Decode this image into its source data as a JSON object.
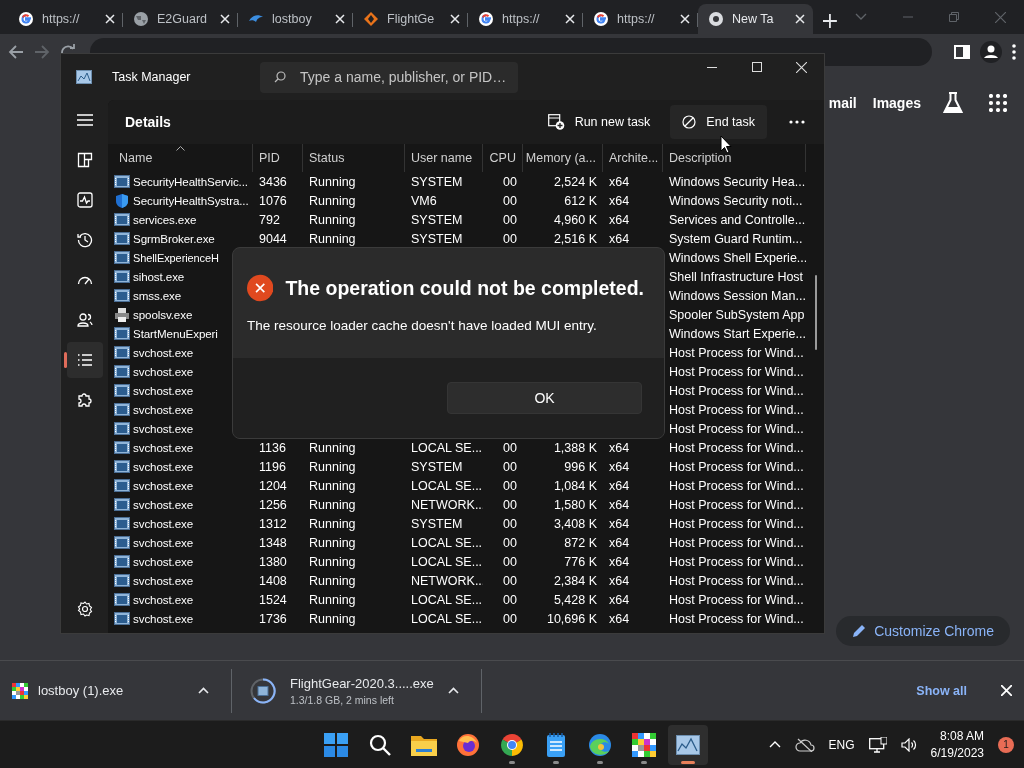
{
  "browser": {
    "tabs": [
      {
        "title": "https://",
        "kind": "google",
        "selected": false
      },
      {
        "title": "E2Guard",
        "kind": "globe",
        "selected": false
      },
      {
        "title": "lostboy",
        "kind": "swoosh",
        "selected": false
      },
      {
        "title": "FlightGe",
        "kind": "diamond",
        "selected": false
      },
      {
        "title": "https://",
        "kind": "google",
        "selected": false
      },
      {
        "title": "https://",
        "kind": "google",
        "selected": false
      },
      {
        "title": "New Ta",
        "kind": "ring",
        "selected": true
      }
    ],
    "page_links": [
      "mail",
      "Images"
    ],
    "customize_button": "Customize Chrome"
  },
  "task_manager": {
    "title": "Task Manager",
    "search": {
      "placeholder": "Type a name, publisher, or PID…"
    },
    "sidebar": [
      {
        "kind": "processes",
        "selected": false
      },
      {
        "kind": "performance",
        "selected": false
      },
      {
        "kind": "history",
        "selected": false
      },
      {
        "kind": "startup",
        "selected": false
      },
      {
        "kind": "users",
        "selected": false
      },
      {
        "kind": "details",
        "selected": true
      },
      {
        "kind": "services",
        "selected": false
      }
    ],
    "page_title": "Details",
    "actions": [
      {
        "kind": "run",
        "label": "Run new task"
      },
      {
        "kind": "end",
        "label": "End task"
      }
    ],
    "columns": [
      {
        "label": "Name",
        "sorted": true
      },
      {
        "label": "PID",
        "sorted": false
      },
      {
        "label": "Status",
        "sorted": false
      },
      {
        "label": "User name",
        "sorted": false
      },
      {
        "label": "CPU",
        "sorted": false
      },
      {
        "label": "Memory (a...",
        "sorted": false
      },
      {
        "label": "Archite...",
        "sorted": false
      },
      {
        "label": "Description",
        "sorted": false
      }
    ],
    "rows": [
      {
        "kind": "app",
        "name": "SecurityHealthServic...",
        "pid": "3436",
        "status": "Running",
        "user": "SYSTEM",
        "cpu": "00",
        "memory": "2,524 K",
        "arch": "x64",
        "description": "Windows Security Hea..."
      },
      {
        "kind": "shield",
        "name": "SecurityHealthSystra...",
        "pid": "1076",
        "status": "Running",
        "user": "VM6",
        "cpu": "00",
        "memory": "612 K",
        "arch": "x64",
        "description": "Windows Security noti..."
      },
      {
        "kind": "app",
        "name": "services.exe",
        "pid": "792",
        "status": "Running",
        "user": "SYSTEM",
        "cpu": "00",
        "memory": "4,960 K",
        "arch": "x64",
        "description": "Services and Controlle..."
      },
      {
        "kind": "app",
        "name": "SgrmBroker.exe",
        "pid": "9044",
        "status": "Running",
        "user": "SYSTEM",
        "cpu": "00",
        "memory": "2,516 K",
        "arch": "x64",
        "description": "System Guard Runtim..."
      },
      {
        "kind": "app",
        "name": "ShellExperienceH",
        "description": "Windows Shell Experie..."
      },
      {
        "kind": "app",
        "name": "sihost.exe",
        "description": "Shell Infrastructure Host"
      },
      {
        "kind": "app",
        "name": "smss.exe",
        "description": "Windows Session Man..."
      },
      {
        "kind": "printer",
        "name": "spoolsv.exe",
        "description": "Spooler SubSystem App"
      },
      {
        "kind": "app",
        "name": "StartMenuExperi",
        "description": "Windows Start Experie..."
      },
      {
        "kind": "app",
        "name": "svchost.exe",
        "description": "Host Process for Wind..."
      },
      {
        "kind": "app",
        "name": "svchost.exe",
        "description": "Host Process for Wind..."
      },
      {
        "kind": "app",
        "name": "svchost.exe",
        "description": "Host Process for Wind..."
      },
      {
        "kind": "app",
        "name": "svchost.exe",
        "description": "Host Process for Wind..."
      },
      {
        "kind": "app",
        "name": "svchost.exe",
        "description": "Host Process for Wind..."
      },
      {
        "kind": "app",
        "name": "svchost.exe",
        "pid": "1136",
        "status": "Running",
        "user": "LOCAL SE...",
        "cpu": "00",
        "memory": "1,388 K",
        "arch": "x64",
        "description": "Host Process for Wind..."
      },
      {
        "kind": "app",
        "name": "svchost.exe",
        "pid": "1196",
        "status": "Running",
        "user": "SYSTEM",
        "cpu": "00",
        "memory": "996 K",
        "arch": "x64",
        "description": "Host Process for Wind..."
      },
      {
        "kind": "app",
        "name": "svchost.exe",
        "pid": "1204",
        "status": "Running",
        "user": "LOCAL SE...",
        "cpu": "00",
        "memory": "1,084 K",
        "arch": "x64",
        "description": "Host Process for Wind..."
      },
      {
        "kind": "app",
        "name": "svchost.exe",
        "pid": "1256",
        "status": "Running",
        "user": "NETWORK...",
        "cpu": "00",
        "memory": "1,580 K",
        "arch": "x64",
        "description": "Host Process for Wind..."
      },
      {
        "kind": "app",
        "name": "svchost.exe",
        "pid": "1312",
        "status": "Running",
        "user": "SYSTEM",
        "cpu": "00",
        "memory": "3,408 K",
        "arch": "x64",
        "description": "Host Process for Wind..."
      },
      {
        "kind": "app",
        "name": "svchost.exe",
        "pid": "1348",
        "status": "Running",
        "user": "LOCAL SE...",
        "cpu": "00",
        "memory": "872 K",
        "arch": "x64",
        "description": "Host Process for Wind..."
      },
      {
        "kind": "app",
        "name": "svchost.exe",
        "pid": "1380",
        "status": "Running",
        "user": "LOCAL SE...",
        "cpu": "00",
        "memory": "776 K",
        "arch": "x64",
        "description": "Host Process for Wind..."
      },
      {
        "kind": "app",
        "name": "svchost.exe",
        "pid": "1408",
        "status": "Running",
        "user": "NETWORK...",
        "cpu": "00",
        "memory": "2,384 K",
        "arch": "x64",
        "description": "Host Process for Wind..."
      },
      {
        "kind": "app",
        "name": "svchost.exe",
        "pid": "1524",
        "status": "Running",
        "user": "LOCAL SE...",
        "cpu": "00",
        "memory": "5,428 K",
        "arch": "x64",
        "description": "Host Process for Wind..."
      },
      {
        "kind": "app",
        "name": "svchost.exe",
        "pid": "1736",
        "status": "Running",
        "user": "LOCAL SE...",
        "cpu": "00",
        "memory": "10,696 K",
        "arch": "x64",
        "description": "Host Process for Wind..."
      }
    ]
  },
  "dialog": {
    "title": "The operation could not be completed.",
    "message": "The resource loader cache doesn't have loaded MUI entry.",
    "button": "OK"
  },
  "downloads": {
    "items": [
      {
        "kind": "pixel",
        "name": "lostboy (1).exe"
      },
      {
        "kind": "progress",
        "name": "FlightGear-2020.3.....exe",
        "status": "1.3/1.8 GB, 2 mins left"
      }
    ],
    "show_all": "Show all"
  },
  "taskbar": {
    "apps": [
      {
        "kind": "start",
        "open": false,
        "active": false
      },
      {
        "kind": "search",
        "open": false,
        "active": false
      },
      {
        "kind": "folder",
        "open": false,
        "active": false
      },
      {
        "kind": "firefox",
        "open": false,
        "active": false
      },
      {
        "kind": "chrome",
        "open": true,
        "active": false
      },
      {
        "kind": "notepad",
        "open": true,
        "active": false
      },
      {
        "kind": "edge",
        "open": true,
        "active": false
      },
      {
        "kind": "pixel",
        "open": true,
        "active": false
      },
      {
        "kind": "taskmgr",
        "open": true,
        "active": true
      }
    ],
    "language": "ENG",
    "time": "8:08 AM",
    "date": "6/19/2023",
    "notification_count": "1"
  }
}
